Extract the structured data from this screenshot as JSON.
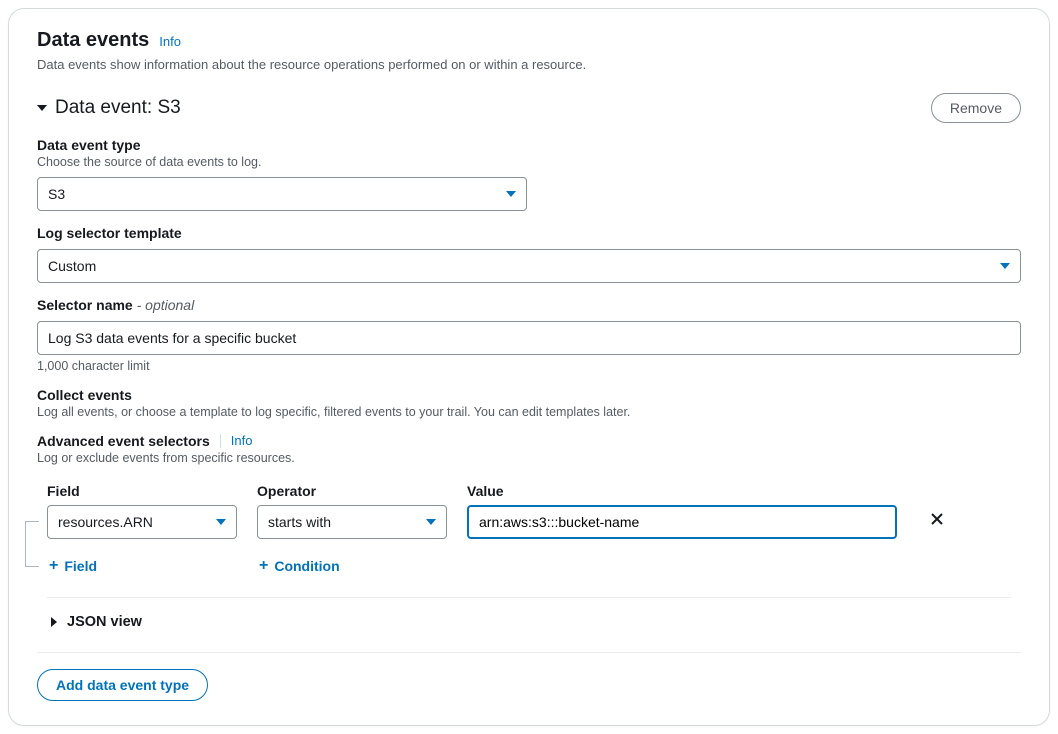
{
  "header": {
    "title": "Data events",
    "info": "Info",
    "description": "Data events show information about the resource operations performed on or within a resource."
  },
  "dataEvent": {
    "titlePrefix": "Data event:",
    "type": "S3",
    "removeLabel": "Remove"
  },
  "eventType": {
    "label": "Data event type",
    "description": "Choose the source of data events to log.",
    "value": "S3"
  },
  "logSelector": {
    "label": "Log selector template",
    "value": "Custom"
  },
  "selectorName": {
    "label": "Selector name",
    "optional": "- optional",
    "value": "Log S3 data events for a specific bucket",
    "helper": "1,000 character limit"
  },
  "collectEvents": {
    "label": "Collect events",
    "description": "Log all events, or choose a template to log specific, filtered events to your trail. You can edit templates later."
  },
  "advanced": {
    "label": "Advanced event selectors",
    "info": "Info",
    "description": "Log or exclude events from specific resources."
  },
  "columns": {
    "field": "Field",
    "operator": "Operator",
    "value": "Value"
  },
  "row": {
    "field": "resources.ARN",
    "operator": "starts with",
    "value": "arn:aws:s3:::bucket-name"
  },
  "add": {
    "field": "Field",
    "condition": "Condition"
  },
  "jsonView": "JSON view",
  "addDataEventType": "Add data event type"
}
